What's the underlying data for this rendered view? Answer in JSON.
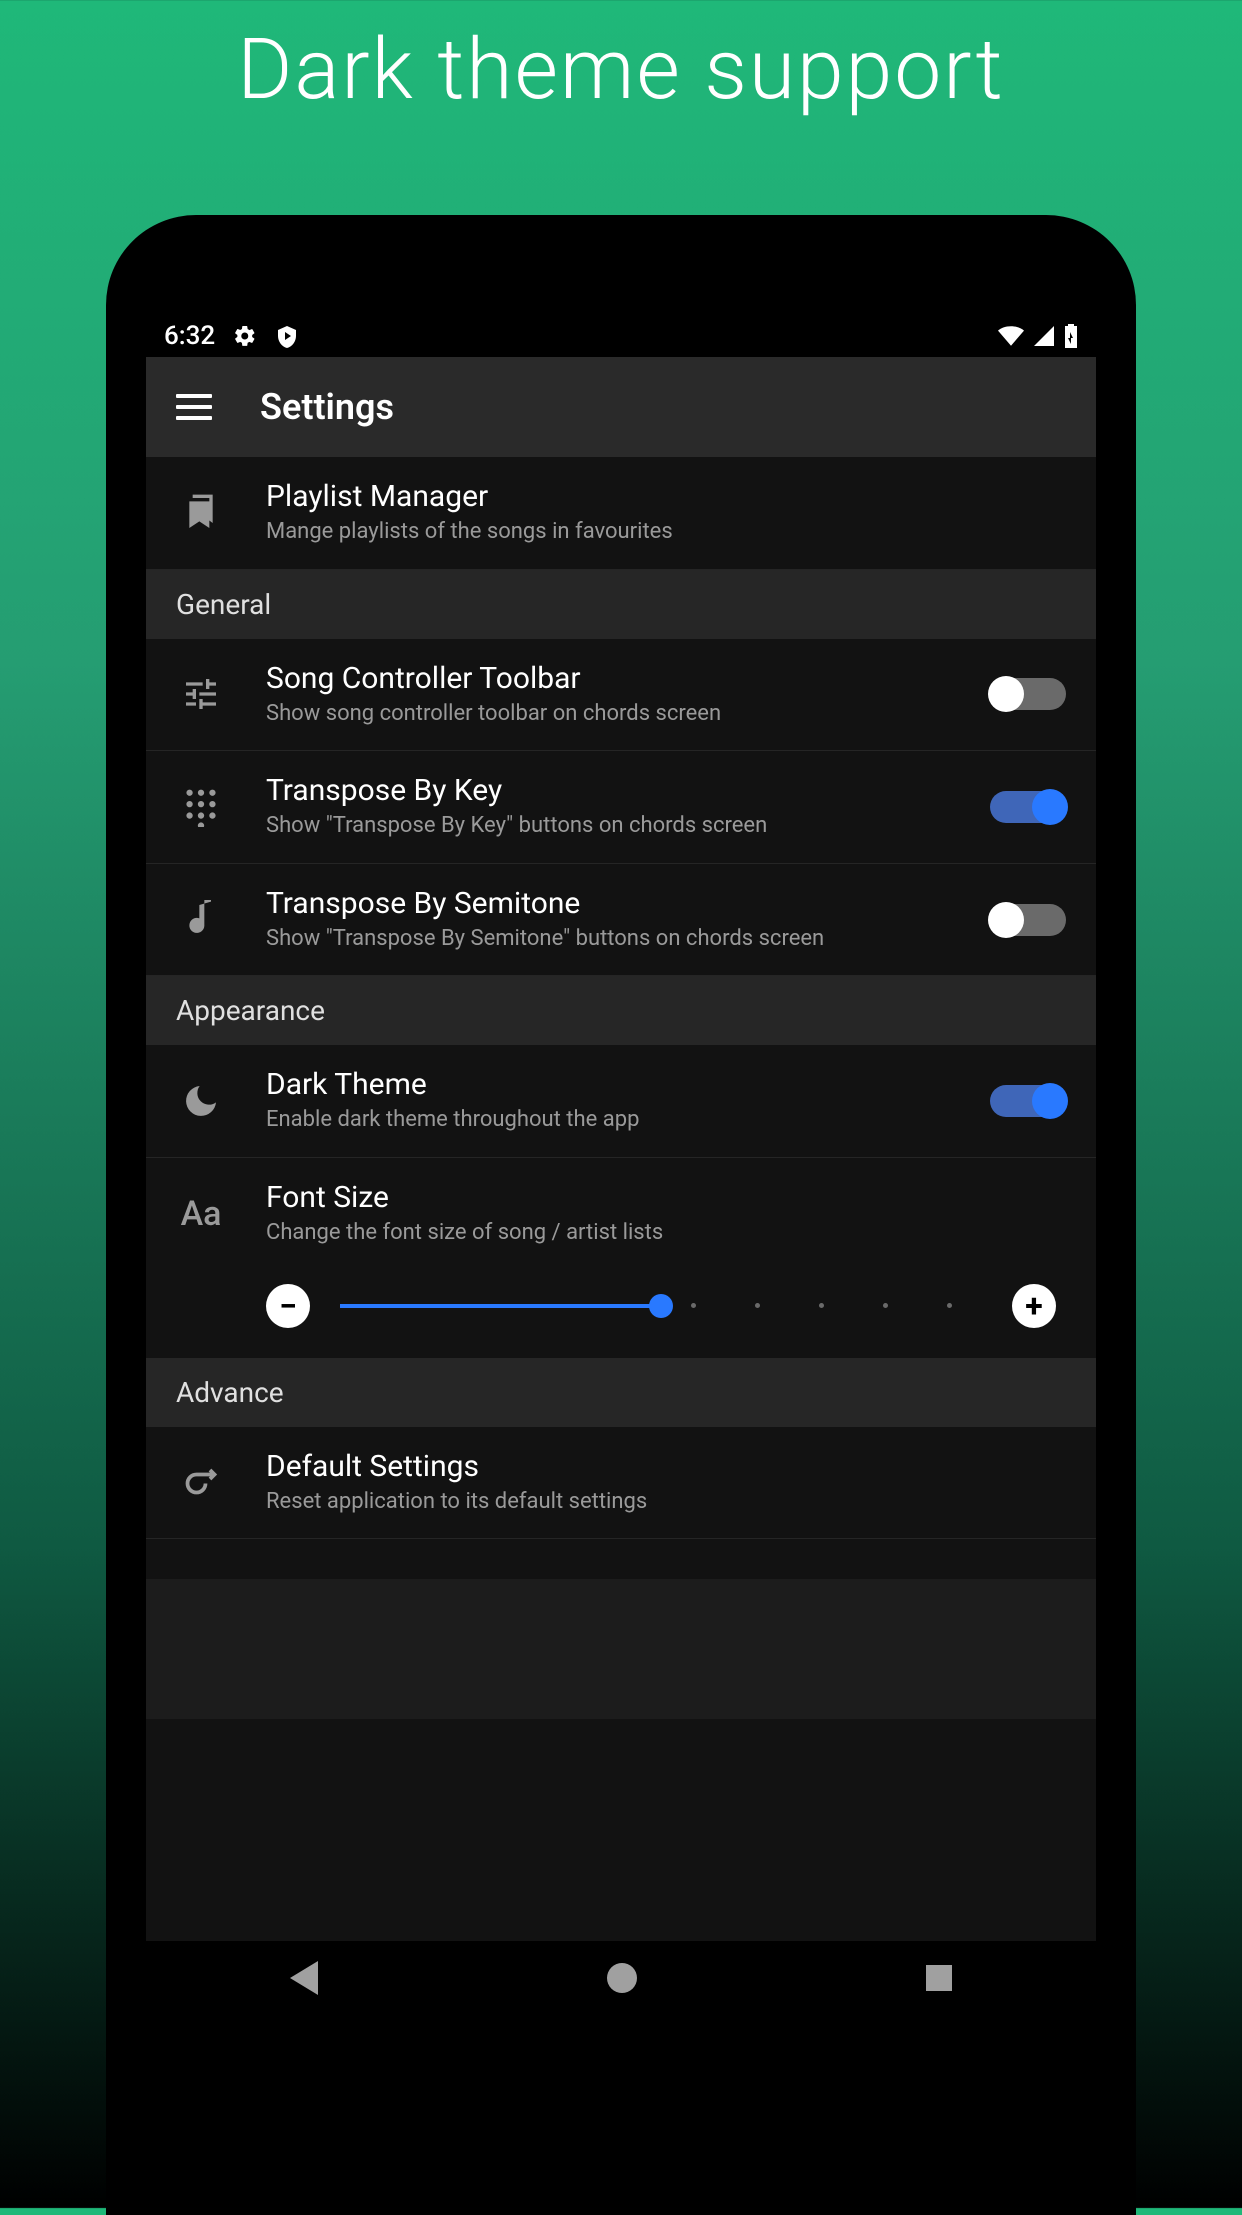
{
  "headline": "Dark theme support",
  "status": {
    "time": "6:32"
  },
  "appbar": {
    "title": "Settings"
  },
  "rows": {
    "playlist": {
      "title": "Playlist Manager",
      "desc": "Mange playlists of the songs in favourites"
    },
    "song_controller": {
      "title": "Song Controller Toolbar",
      "desc": "Show song controller toolbar on chords screen",
      "on": false
    },
    "transpose_key": {
      "title": "Transpose By Key",
      "desc": "Show \"Transpose By Key\" buttons on chords screen",
      "on": true
    },
    "transpose_semitone": {
      "title": "Transpose By Semitone",
      "desc": "Show \"Transpose By Semitone\" buttons on chords screen",
      "on": false
    },
    "dark_theme": {
      "title": "Dark Theme",
      "desc": "Enable dark theme throughout the app",
      "on": true
    },
    "font_size": {
      "title": "Font Size",
      "desc": "Change the font size of song / artist lists",
      "slider_value": 50,
      "slider_min": 0,
      "slider_max": 100
    },
    "default_settings": {
      "title": "Default Settings",
      "desc": "Reset application to its default settings"
    }
  },
  "sections": {
    "general": "General",
    "appearance": "Appearance",
    "advance": "Advance"
  },
  "slider_buttons": {
    "minus": "−",
    "plus": "+"
  },
  "colors": {
    "accent": "#2979ff",
    "bg_green_top": "#1fb879",
    "bg_dark": "#121212"
  }
}
